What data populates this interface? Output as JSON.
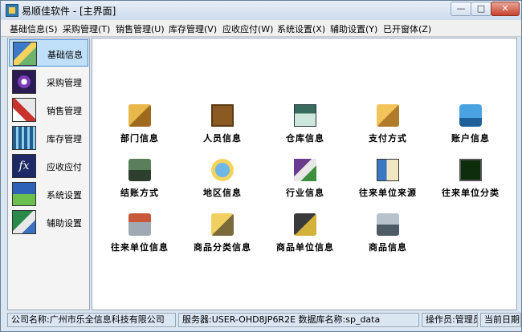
{
  "window": {
    "title": "易顺佳软件 - [主界面]"
  },
  "window_buttons": {
    "minimize": "—",
    "maximize": "□",
    "close": "✕"
  },
  "menu": [
    "基础信息(S)",
    "采购管理(T)",
    "销售管理(U)",
    "库存管理(V)",
    "应收应付(W)",
    "系统设置(X)",
    "辅助设置(Y)",
    "已开窗体(Z)"
  ],
  "sidebar": [
    {
      "label": "基础信息",
      "icon": "basic-info-icon",
      "active": true
    },
    {
      "label": "采购管理",
      "icon": "purchase-icon",
      "active": false
    },
    {
      "label": "销售管理",
      "icon": "sales-icon",
      "active": false
    },
    {
      "label": "库存管理",
      "icon": "inventory-icon",
      "active": false
    },
    {
      "label": "应收应付",
      "icon": "receivable-icon",
      "active": false
    },
    {
      "label": "系统设置",
      "icon": "system-settings-icon",
      "active": false
    },
    {
      "label": "辅助设置",
      "icon": "aux-settings-icon",
      "active": false
    }
  ],
  "tiles": [
    {
      "label": "部门信息",
      "icon": "department-icon"
    },
    {
      "label": "人员信息",
      "icon": "personnel-icon"
    },
    {
      "label": "仓库信息",
      "icon": "warehouse-icon"
    },
    {
      "label": "支付方式",
      "icon": "payment-method-icon"
    },
    {
      "label": "账户信息",
      "icon": "account-icon"
    },
    {
      "label": "结账方式",
      "icon": "settlement-icon"
    },
    {
      "label": "地区信息",
      "icon": "region-icon"
    },
    {
      "label": "行业信息",
      "icon": "industry-icon"
    },
    {
      "label": "往来单位来源",
      "icon": "partner-source-icon"
    },
    {
      "label": "往来单位分类",
      "icon": "partner-category-icon"
    },
    {
      "label": "往来单位信息",
      "icon": "partner-info-icon"
    },
    {
      "label": "商品分类信息",
      "icon": "product-category-icon"
    },
    {
      "label": "商品单位信息",
      "icon": "product-unit-icon"
    },
    {
      "label": "商品信息",
      "icon": "product-info-icon"
    }
  ],
  "status": {
    "company": "公司名称:广州市乐全信息科技有限公司",
    "server": "服务器:USER-OHD8JP6R2E   数据库名称:sp_data",
    "operator": "操作员:管理员",
    "date": "当前日期"
  },
  "colors": {
    "window_bg": "#dbe6f3",
    "active_item": "#bfe0f8",
    "content_bg": "#ffffff"
  }
}
